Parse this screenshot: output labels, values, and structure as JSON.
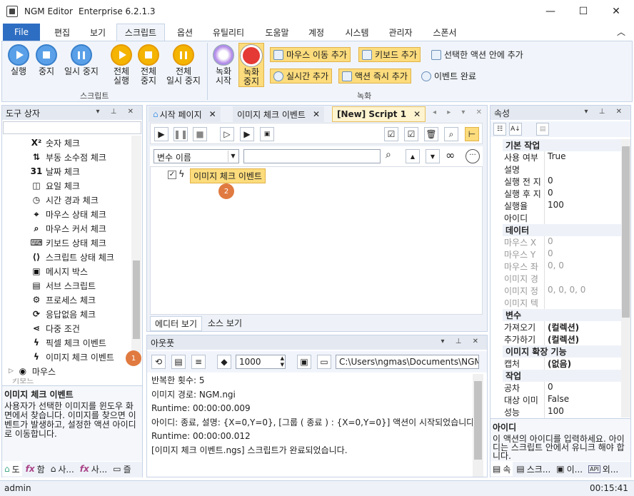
{
  "window": {
    "app_name": "NGM Editor",
    "edition": "Enterprise 6.2.1.3",
    "minimize": "—",
    "maximize": "☐",
    "close": "✕"
  },
  "menu": {
    "file": "File",
    "tabs": [
      "편집",
      "보기",
      "스크립트",
      "옵션",
      "유틸리티",
      "도움말",
      "계정",
      "시스템",
      "관리자",
      "스폰서"
    ],
    "active_tab": "스크립트",
    "collapse": "︿"
  },
  "ribbon": {
    "group_script": "스크립트",
    "group_record": "녹화",
    "run": "실행",
    "stop": "중지",
    "pause": "일시 중지",
    "run_all_1": "전체",
    "run_all_2": "실행",
    "stop_all_1": "전체",
    "stop_all_2": "중지",
    "pause_all_1": "전체",
    "pause_all_2": "일시 중지",
    "rec_start_1": "녹화",
    "rec_start_2": "시작",
    "rec_stop_1": "녹화",
    "rec_stop_2": "중지",
    "add_mouse": "마우스 이동 추가",
    "add_keyboard": "키보드 추가",
    "add_in_selected": "선택한 액션 안에 추가",
    "add_realtime": "실시간 추가",
    "add_action_now": "액션 즉시 추가",
    "end_event": "이벤트 완료"
  },
  "toolbox": {
    "title": "도구 상자",
    "search_placeholder": "",
    "items": [
      {
        "icon": "x-squared-icon",
        "glyph": "X²",
        "label": "숫자 체크"
      },
      {
        "icon": "float-icon",
        "glyph": "⇅",
        "label": "부동 소수점 체크"
      },
      {
        "icon": "calendar-icon",
        "glyph": "31",
        "label": "날짜 체크"
      },
      {
        "icon": "weekday-icon",
        "glyph": "◫",
        "label": "요일 체크"
      },
      {
        "icon": "clock-icon",
        "glyph": "◷",
        "label": "시간 경과 체크"
      },
      {
        "icon": "mouse-state-icon",
        "glyph": "⌖",
        "label": "마우스 상태 체크"
      },
      {
        "icon": "mouse-cursor-icon",
        "glyph": "⌕",
        "label": "마우스 커서 체크"
      },
      {
        "icon": "keyboard-icon",
        "glyph": "⌨",
        "label": "키보드 상태 체크"
      },
      {
        "icon": "script-state-icon",
        "glyph": "⟨⟩",
        "label": "스크립트 상태 체크"
      },
      {
        "icon": "message-box-icon",
        "glyph": "▣",
        "label": "메시지 박스"
      },
      {
        "icon": "sub-script-icon",
        "glyph": "▤",
        "label": "서브 스크립트"
      },
      {
        "icon": "process-icon",
        "glyph": "⚙",
        "label": "프로세스 체크"
      },
      {
        "icon": "no-response-icon",
        "glyph": "⟳",
        "label": "응답없음 체크"
      },
      {
        "icon": "multi-condition-icon",
        "glyph": "⋖",
        "label": "다중 조건"
      },
      {
        "icon": "pixel-event-icon",
        "glyph": "ϟ",
        "label": "픽셀 체크 이벤트"
      },
      {
        "icon": "image-event-icon",
        "glyph": "ϟ",
        "label": "이미지 체크 이벤트"
      }
    ],
    "collapsed_group": "마우스",
    "collapsed_group2": "키보드",
    "badge1": "1",
    "desc_title": "이미지 체크 이벤트",
    "desc_text": "사용자가 선택한 이미지를 윈도우 화면에서 찾습니다. 이미지를 찾으면 이벤트가 발생하고, 설정한 액션 아이디로 이동합니다.",
    "bottom_tabs": [
      "도",
      "함",
      "사...",
      "사...",
      "즐"
    ]
  },
  "editor": {
    "tabs": [
      {
        "label": "시작 페이지",
        "close": "✕"
      },
      {
        "label": "이미지 체크 이벤트",
        "close": "✕"
      },
      {
        "label": "[New] Script 1",
        "close": "✕"
      }
    ],
    "var_select": "변수 이름",
    "var_value": "",
    "node_label": "이미지 체크 이벤트",
    "badge2": "2",
    "view_tabs": [
      "에디터 보기",
      "소스 보기"
    ]
  },
  "output": {
    "title": "아웃풋",
    "delay_value": "1000",
    "path_value": "C:\\Users\\ngmas\\Documents\\NGM6\\",
    "lines": [
      "반복한 횟수: 5",
      "이미지 경로: NGM.ngi",
      "Runtime: 00:00:00.009",
      "아이디: 종료, 설명: {X=0,Y=0}, [그룹 ( 종료 ) : {X=0,Y=0}] 액션이 시작되었습니다.",
      "Runtime: 00:00:00.012",
      "[이미지 체크 이벤트.ngs] 스크립트가 완료되었습니다."
    ]
  },
  "properties": {
    "title": "속성",
    "categories": [
      {
        "name": "기본 작업",
        "rows": [
          {
            "k": "사용 여부",
            "v": "True",
            "dis": false
          },
          {
            "k": "설명",
            "v": "",
            "dis": false
          },
          {
            "k": "실행 전 지",
            "v": "0",
            "dis": false
          },
          {
            "k": "실행 후 지",
            "v": "0",
            "dis": false
          },
          {
            "k": "실행율",
            "v": "100",
            "dis": false
          },
          {
            "k": "아이디",
            "v": "",
            "dis": false
          }
        ]
      },
      {
        "name": "데이터",
        "rows": [
          {
            "k": "마우스 X",
            "v": "0",
            "dis": true
          },
          {
            "k": "마우스 Y",
            "v": "0",
            "dis": true
          },
          {
            "k": "마우스 좌",
            "v": "0, 0",
            "dis": true
          },
          {
            "k": "이미지 경",
            "v": "",
            "dis": true
          },
          {
            "k": "이미지 정",
            "v": "0, 0, 0, 0",
            "dis": true
          },
          {
            "k": "이미지 텍",
            "v": "",
            "dis": true
          }
        ]
      },
      {
        "name": "변수",
        "rows": [
          {
            "k": "가져오기",
            "v": "(컬렉션)",
            "dis": false
          },
          {
            "k": "추가하기",
            "v": "(컬렉션)",
            "dis": false
          }
        ]
      },
      {
        "name": "이미지 확장 기능",
        "rows": [
          {
            "k": "캡처",
            "v": "(없음)",
            "dis": false
          }
        ]
      },
      {
        "name": "작업",
        "rows": [
          {
            "k": "공차",
            "v": "0",
            "dis": false
          },
          {
            "k": "대상 이미",
            "v": "False",
            "dis": false
          },
          {
            "k": "성능",
            "v": "100",
            "dis": false
          }
        ]
      }
    ],
    "desc_title": "아이디",
    "desc_text": "이 액션의 아이디를 입력하세요. 아이디는 스크립트 안에서 유니크 해야 합니다.",
    "bottom_tabs": [
      "속",
      "스크...",
      "이...",
      "외..."
    ]
  },
  "status": {
    "user": "admin",
    "time": "00:15:41"
  }
}
